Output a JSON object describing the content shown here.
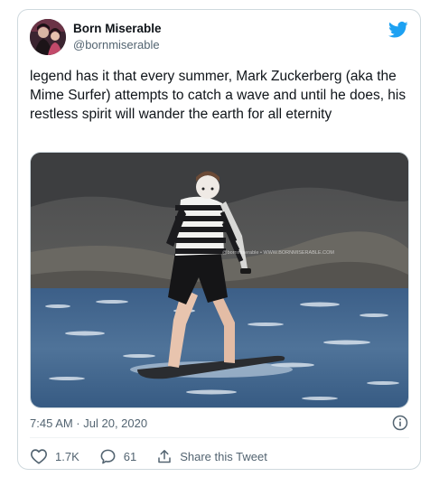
{
  "tweet": {
    "author": {
      "display_name": "Born Miserable",
      "handle": "@bornmiserable"
    },
    "text": "legend has it that every summer, Mark Zuckerberg (aka the Mime Surfer) attempts to catch a wave and until he does, his restless spirit will wander the earth for all eternity",
    "media": {
      "watermark": "@bornmiserable • WWW.BORNMISERABLE.COM"
    },
    "timestamp": "7:45 AM · Jul 20, 2020",
    "actions": {
      "likes": "1.7K",
      "replies": "61",
      "share_label": "Share this Tweet"
    }
  },
  "icons": {
    "brand": "twitter-bird-icon",
    "info": "info-icon",
    "like": "heart-icon",
    "reply": "comment-icon",
    "share": "share-icon"
  },
  "colors": {
    "brand_blue": "#1da1f2",
    "text_primary": "#0f1419",
    "text_secondary": "#536471",
    "border": "#cfd9de"
  }
}
